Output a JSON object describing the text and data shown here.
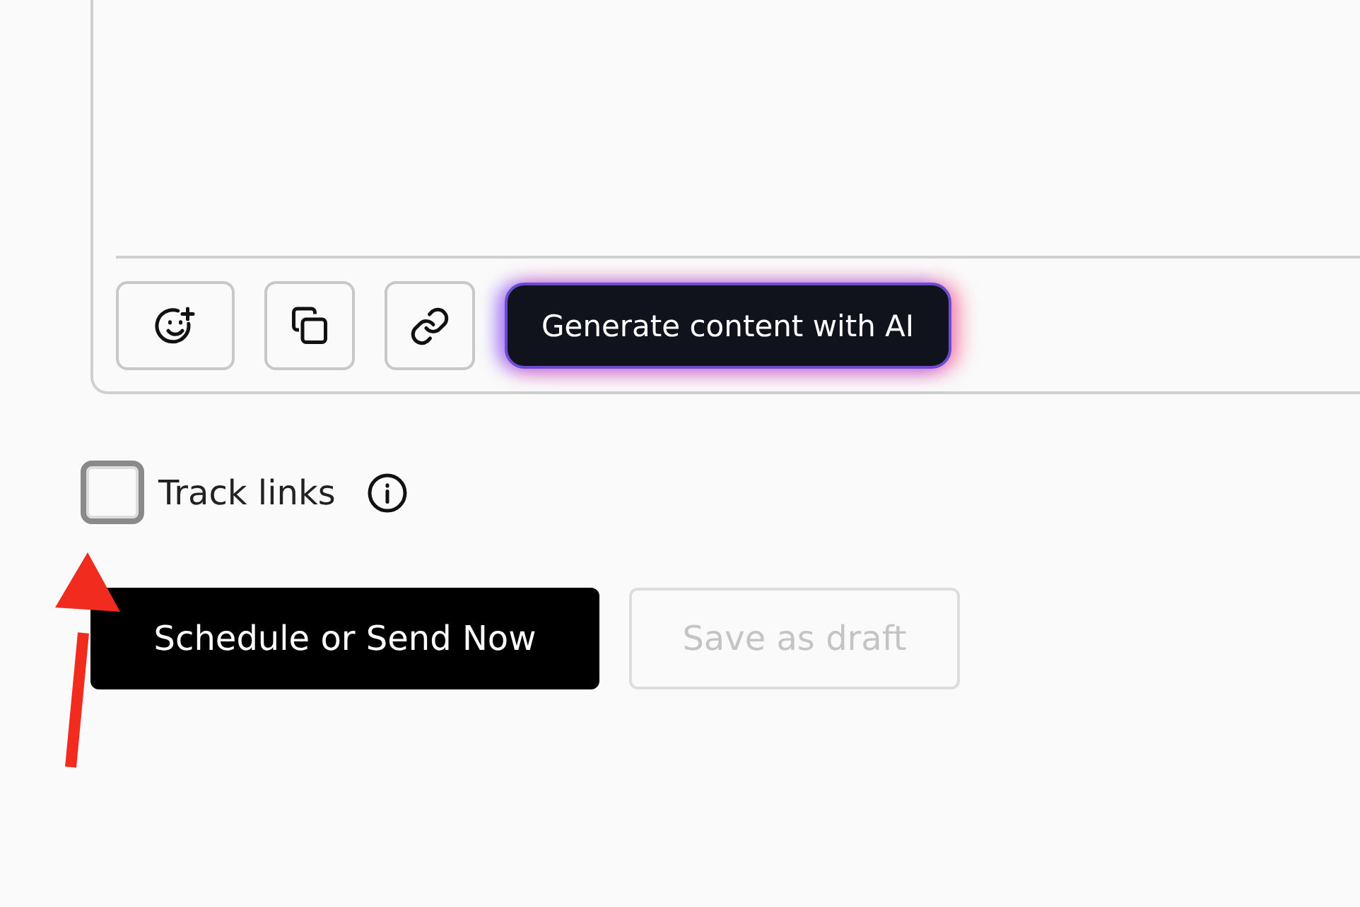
{
  "editor": {
    "toolbar": [
      {
        "kind": "emoji"
      },
      {
        "kind": "copy"
      },
      {
        "kind": "link"
      }
    ],
    "ai_button": {
      "label": "Generate content with AI"
    }
  },
  "track_links": {
    "label": "Track links",
    "checked": false
  },
  "actions": [
    {
      "label": "Schedule or Send Now",
      "kind": "primary",
      "disabled": false
    },
    {
      "label": "Save as draft",
      "kind": "secondary",
      "disabled": true
    }
  ]
}
